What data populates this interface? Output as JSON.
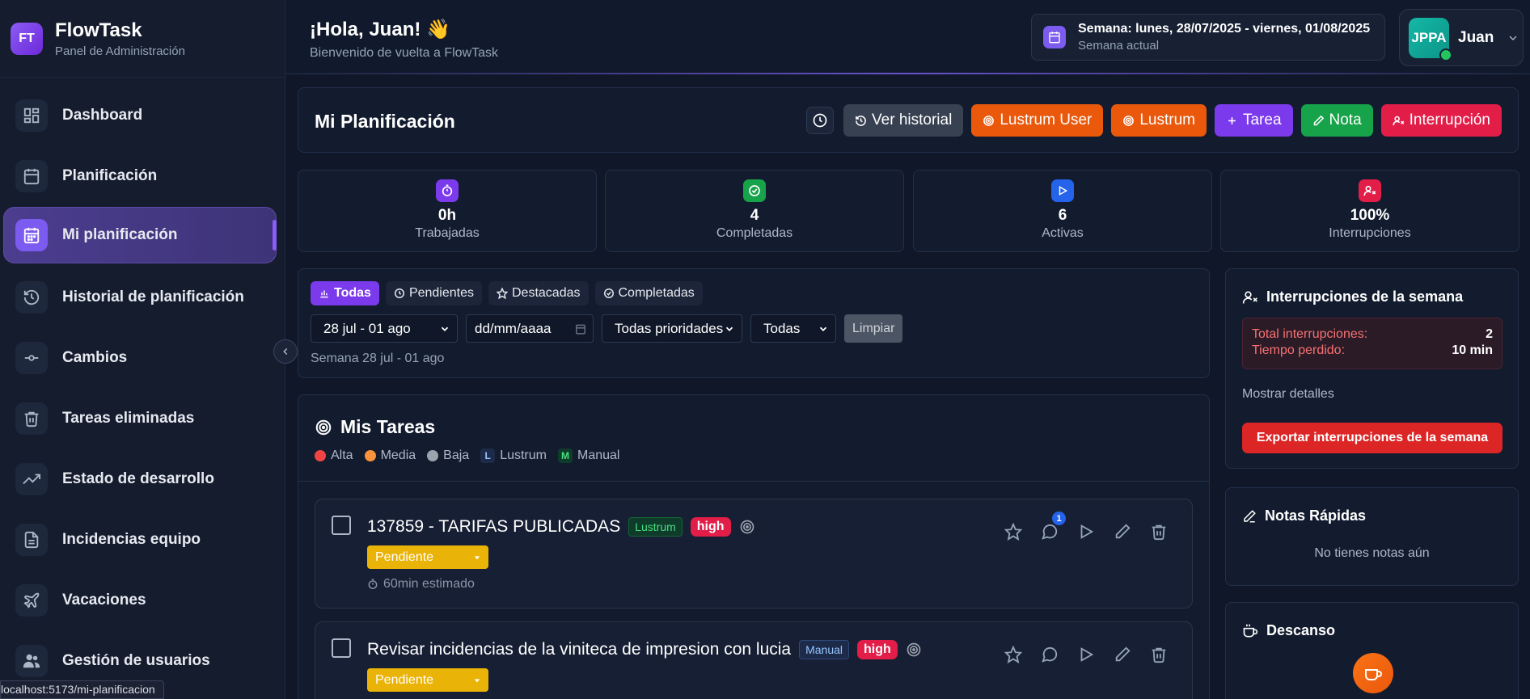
{
  "brand": {
    "logo": "FT",
    "title": "FlowTask",
    "subtitle": "Panel de Administración"
  },
  "sidebar": {
    "items": [
      {
        "label": "Dashboard",
        "icon": "grid-icon",
        "active": false
      },
      {
        "label": "Planificación",
        "icon": "calendar-icon",
        "active": false
      },
      {
        "label": "Mi planificación",
        "icon": "calendar-grid-icon",
        "active": true
      },
      {
        "label": "Historial de planificación",
        "icon": "history-icon",
        "active": false
      },
      {
        "label": "Cambios",
        "icon": "commit-icon",
        "active": false
      },
      {
        "label": "Tareas eliminadas",
        "icon": "trash-icon",
        "active": false
      },
      {
        "label": "Estado de desarrollo",
        "icon": "trending-up-icon",
        "active": false
      },
      {
        "label": "Incidencias equipo",
        "icon": "file-text-icon",
        "active": false
      },
      {
        "label": "Vacaciones",
        "icon": "plane-icon",
        "active": false
      },
      {
        "label": "Gestión de usuarios",
        "icon": "users-icon",
        "active": false
      }
    ]
  },
  "status_url": "localhost:5173/mi-planificacion",
  "header": {
    "greeting": "¡Hola, Juan! 👋",
    "subtitle": "Bienvenido de vuelta a FlowTask",
    "week_title": "Semana: lunes, 28/07/2025 - viernes, 01/08/2025",
    "week_sub": "Semana actual",
    "user_initials": "JPPA",
    "user_name": "Juan"
  },
  "planning": {
    "title": "Mi Planificación",
    "buttons": {
      "history": "Ver historial",
      "lustrum_user": "Lustrum User",
      "lustrum": "Lustrum",
      "task": "Tarea",
      "note": "Nota",
      "interruption": "Interrupción"
    }
  },
  "stats": [
    {
      "value": "0h",
      "label": "Trabajadas",
      "color": "#7c3aed",
      "icon": "timer-icon"
    },
    {
      "value": "4",
      "label": "Completadas",
      "color": "#16a34a",
      "icon": "check-circle-icon"
    },
    {
      "value": "6",
      "label": "Activas",
      "color": "#2563eb",
      "icon": "play-icon"
    },
    {
      "value": "100%",
      "label": "Interrupciones",
      "color": "#e11d48",
      "icon": "user-x-icon"
    }
  ],
  "filters": {
    "tabs": [
      "Todas",
      "Pendientes",
      "Destacadas",
      "Completadas"
    ],
    "week_select": "28 jul - 01 ago",
    "date_placeholder": "dd/mm/aaaa",
    "priority_select": "Todas prioridades",
    "type_select": "Todas",
    "clear": "Limpiar",
    "caption": "Semana 28 jul - 01 ago"
  },
  "tasks": {
    "title": "Mis Tareas",
    "legend": {
      "alta": "Alta",
      "media": "Media",
      "baja": "Baja",
      "lustrum_letter": "L",
      "lustrum": "Lustrum",
      "manual_letter": "M",
      "manual": "Manual"
    },
    "items": [
      {
        "title": "137859 - TARIFAS PUBLICADAS",
        "source": "Lustrum",
        "priority": "high",
        "status": "Pendiente",
        "estimate": "60min estimado",
        "comments": "1"
      },
      {
        "title": "Revisar incidencias de la viniteca de impresion con lucia",
        "source": "Manual",
        "priority": "high",
        "status": "Pendiente",
        "estimate": "",
        "comments": ""
      }
    ]
  },
  "interruptions": {
    "title": "Interrupciones de la semana",
    "total_label": "Total interrupciones:",
    "total_value": "2",
    "lost_label": "Tiempo perdido:",
    "lost_value": "10 min",
    "details": "Mostrar detalles",
    "export": "Exportar interrupciones de la semana"
  },
  "notes": {
    "title": "Notas Rápidas",
    "empty": "No tienes notas aún"
  },
  "break": {
    "title": "Descanso"
  }
}
